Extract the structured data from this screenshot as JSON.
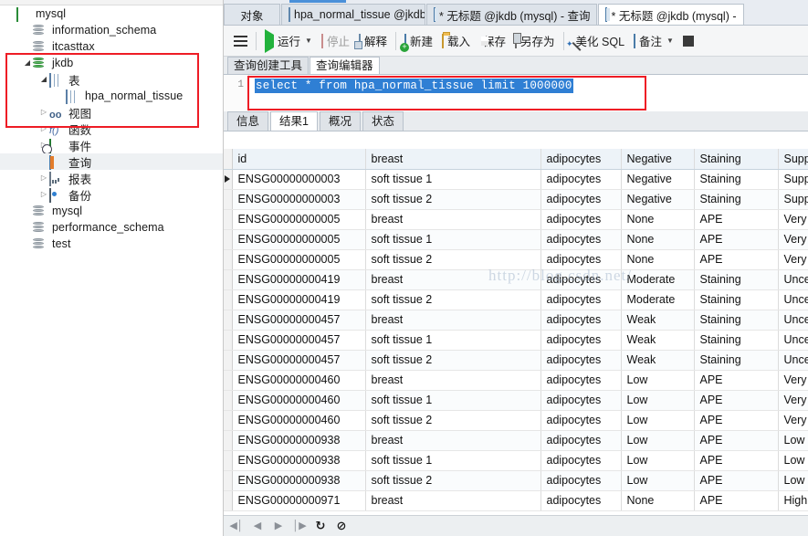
{
  "sidebar": {
    "tree": [
      {
        "label": "mysql",
        "indent": 0,
        "icon": "app-logo-icon",
        "arrow": "",
        "selected": false
      },
      {
        "label": "information_schema",
        "indent": 1,
        "icon": "database-icon",
        "arrow": "",
        "selected": false
      },
      {
        "label": "itcasttax",
        "indent": 1,
        "icon": "database-icon",
        "arrow": "",
        "selected": false
      },
      {
        "label": "jkdb",
        "indent": 1,
        "icon": "database-green-icon",
        "arrow": "open",
        "selected": false
      },
      {
        "label": "表",
        "indent": 2,
        "icon": "table-folder-icon",
        "arrow": "open",
        "selected": false
      },
      {
        "label": "hpa_normal_tissue",
        "indent": 3,
        "icon": "table-icon",
        "arrow": "",
        "selected": false
      },
      {
        "label": "视图",
        "indent": 2,
        "icon": "view-icon",
        "arrow": "closed",
        "selected": false
      },
      {
        "label": "函数",
        "indent": 2,
        "icon": "function-icon",
        "arrow": "closed",
        "selected": false
      },
      {
        "label": "事件",
        "indent": 2,
        "icon": "event-icon",
        "arrow": "closed",
        "selected": false
      },
      {
        "label": "查询",
        "indent": 2,
        "icon": "query-icon",
        "arrow": "",
        "selected": true
      },
      {
        "label": "报表",
        "indent": 2,
        "icon": "report-icon",
        "arrow": "closed",
        "selected": false
      },
      {
        "label": "备份",
        "indent": 2,
        "icon": "backup-icon",
        "arrow": "closed",
        "selected": false
      },
      {
        "label": "mysql",
        "indent": 1,
        "icon": "database-icon",
        "arrow": "",
        "selected": false
      },
      {
        "label": "performance_schema",
        "indent": 1,
        "icon": "database-icon",
        "arrow": "",
        "selected": false
      },
      {
        "label": "test",
        "indent": 1,
        "icon": "database-icon",
        "arrow": "",
        "selected": false
      }
    ]
  },
  "window_tabs": {
    "object_tab": "对象",
    "tabs": [
      {
        "label": "hpa_normal_tissue @jkdb (...",
        "icon": "table-icon",
        "active": false
      },
      {
        "label": "* 无标题 @jkdb (mysql) - 查询",
        "icon": "query-icon",
        "active": false
      },
      {
        "label": "* 无标题 @jkdb (mysql) -",
        "icon": "query-icon",
        "active": true
      }
    ]
  },
  "toolbar": {
    "menu_label": "",
    "items": [
      {
        "label": "运行",
        "icon": "play-icon",
        "caret": true,
        "disabled": false
      },
      {
        "label": "停止",
        "icon": "stop-icon",
        "caret": false,
        "disabled": true
      },
      {
        "label": "解释",
        "icon": "explain-icon",
        "caret": false,
        "disabled": false
      },
      {
        "label": "新建",
        "icon": "new-icon",
        "caret": false,
        "disabled": false
      },
      {
        "label": "载入",
        "icon": "folder-icon",
        "caret": false,
        "disabled": false
      },
      {
        "label": "保存",
        "icon": "save-icon",
        "caret": false,
        "disabled": false
      },
      {
        "label": "另存为",
        "icon": "save-as-icon",
        "caret": false,
        "disabled": false
      },
      {
        "label": "美化 SQL",
        "icon": "wand-icon",
        "caret": false,
        "disabled": false
      },
      {
        "label": "备注",
        "icon": "note-icon",
        "caret": true,
        "disabled": false
      }
    ]
  },
  "query_tabs": [
    {
      "label": "查询创建工具",
      "active": false
    },
    {
      "label": "查询编辑器",
      "active": true
    }
  ],
  "editor": {
    "line_number": "1",
    "sql": "select * from hpa_normal_tissue limit 1000000"
  },
  "result_tabs": [
    {
      "label": "信息",
      "active": false
    },
    {
      "label": "结果1",
      "active": true
    },
    {
      "label": "概况",
      "active": false
    },
    {
      "label": "状态",
      "active": false
    }
  ],
  "grid": {
    "headers": [
      "id",
      "breast",
      "adipocytes",
      "Negative",
      "Staining",
      "Supportive"
    ],
    "rows": [
      {
        "marker": true,
        "cells": [
          "ENSG00000000003",
          "soft tissue 1",
          "adipocytes",
          "Negative",
          "Staining",
          "Supportive"
        ]
      },
      {
        "marker": false,
        "cells": [
          "ENSG00000000003",
          "soft tissue 2",
          "adipocytes",
          "Negative",
          "Staining",
          "Supportive"
        ]
      },
      {
        "marker": false,
        "cells": [
          "ENSG00000000005",
          "breast",
          "adipocytes",
          "None",
          "APE",
          "Very low"
        ]
      },
      {
        "marker": false,
        "cells": [
          "ENSG00000000005",
          "soft tissue 1",
          "adipocytes",
          "None",
          "APE",
          "Very low"
        ]
      },
      {
        "marker": false,
        "cells": [
          "ENSG00000000005",
          "soft tissue 2",
          "adipocytes",
          "None",
          "APE",
          "Very low"
        ]
      },
      {
        "marker": false,
        "cells": [
          "ENSG00000000419",
          "breast",
          "adipocytes",
          "Moderate",
          "Staining",
          "Uncertain"
        ]
      },
      {
        "marker": false,
        "cells": [
          "ENSG00000000419",
          "soft tissue 2",
          "adipocytes",
          "Moderate",
          "Staining",
          "Uncertain"
        ]
      },
      {
        "marker": false,
        "cells": [
          "ENSG00000000457",
          "breast",
          "adipocytes",
          "Weak",
          "Staining",
          "Uncertain"
        ]
      },
      {
        "marker": false,
        "cells": [
          "ENSG00000000457",
          "soft tissue 1",
          "adipocytes",
          "Weak",
          "Staining",
          "Uncertain"
        ]
      },
      {
        "marker": false,
        "cells": [
          "ENSG00000000457",
          "soft tissue 2",
          "adipocytes",
          "Weak",
          "Staining",
          "Uncertain"
        ]
      },
      {
        "marker": false,
        "cells": [
          "ENSG00000000460",
          "breast",
          "adipocytes",
          "Low",
          "APE",
          "Very low"
        ]
      },
      {
        "marker": false,
        "cells": [
          "ENSG00000000460",
          "soft tissue 1",
          "adipocytes",
          "Low",
          "APE",
          "Very low"
        ]
      },
      {
        "marker": false,
        "cells": [
          "ENSG00000000460",
          "soft tissue 2",
          "adipocytes",
          "Low",
          "APE",
          "Very low"
        ]
      },
      {
        "marker": false,
        "cells": [
          "ENSG00000000938",
          "breast",
          "adipocytes",
          "Low",
          "APE",
          "Low"
        ]
      },
      {
        "marker": false,
        "cells": [
          "ENSG00000000938",
          "soft tissue 1",
          "adipocytes",
          "Low",
          "APE",
          "Low"
        ]
      },
      {
        "marker": false,
        "cells": [
          "ENSG00000000938",
          "soft tissue 2",
          "adipocytes",
          "Low",
          "APE",
          "Low"
        ]
      },
      {
        "marker": false,
        "cells": [
          "ENSG00000000971",
          "breast",
          "adipocytes",
          "None",
          "APE",
          "High"
        ]
      }
    ]
  },
  "watermark": {
    "text": "http://blog.csdn.net/"
  },
  "bottom_bar": {
    "buttons": [
      {
        "icon": "first-record-icon",
        "glyph": "◀│"
      },
      {
        "icon": "prev-record-icon",
        "glyph": "◀"
      },
      {
        "icon": "next-record-icon",
        "glyph": "▶"
      },
      {
        "icon": "last-record-icon",
        "glyph": "│▶"
      },
      {
        "icon": "refresh-icon",
        "glyph": "↻"
      },
      {
        "icon": "stop-loading-icon",
        "glyph": "⊘"
      }
    ]
  },
  "colors": {
    "accent_blue": "#2f7fd4",
    "highlight_red": "#ee1c25",
    "tree_green": "#3fb34f",
    "header_bg": "#edf3f8"
  }
}
